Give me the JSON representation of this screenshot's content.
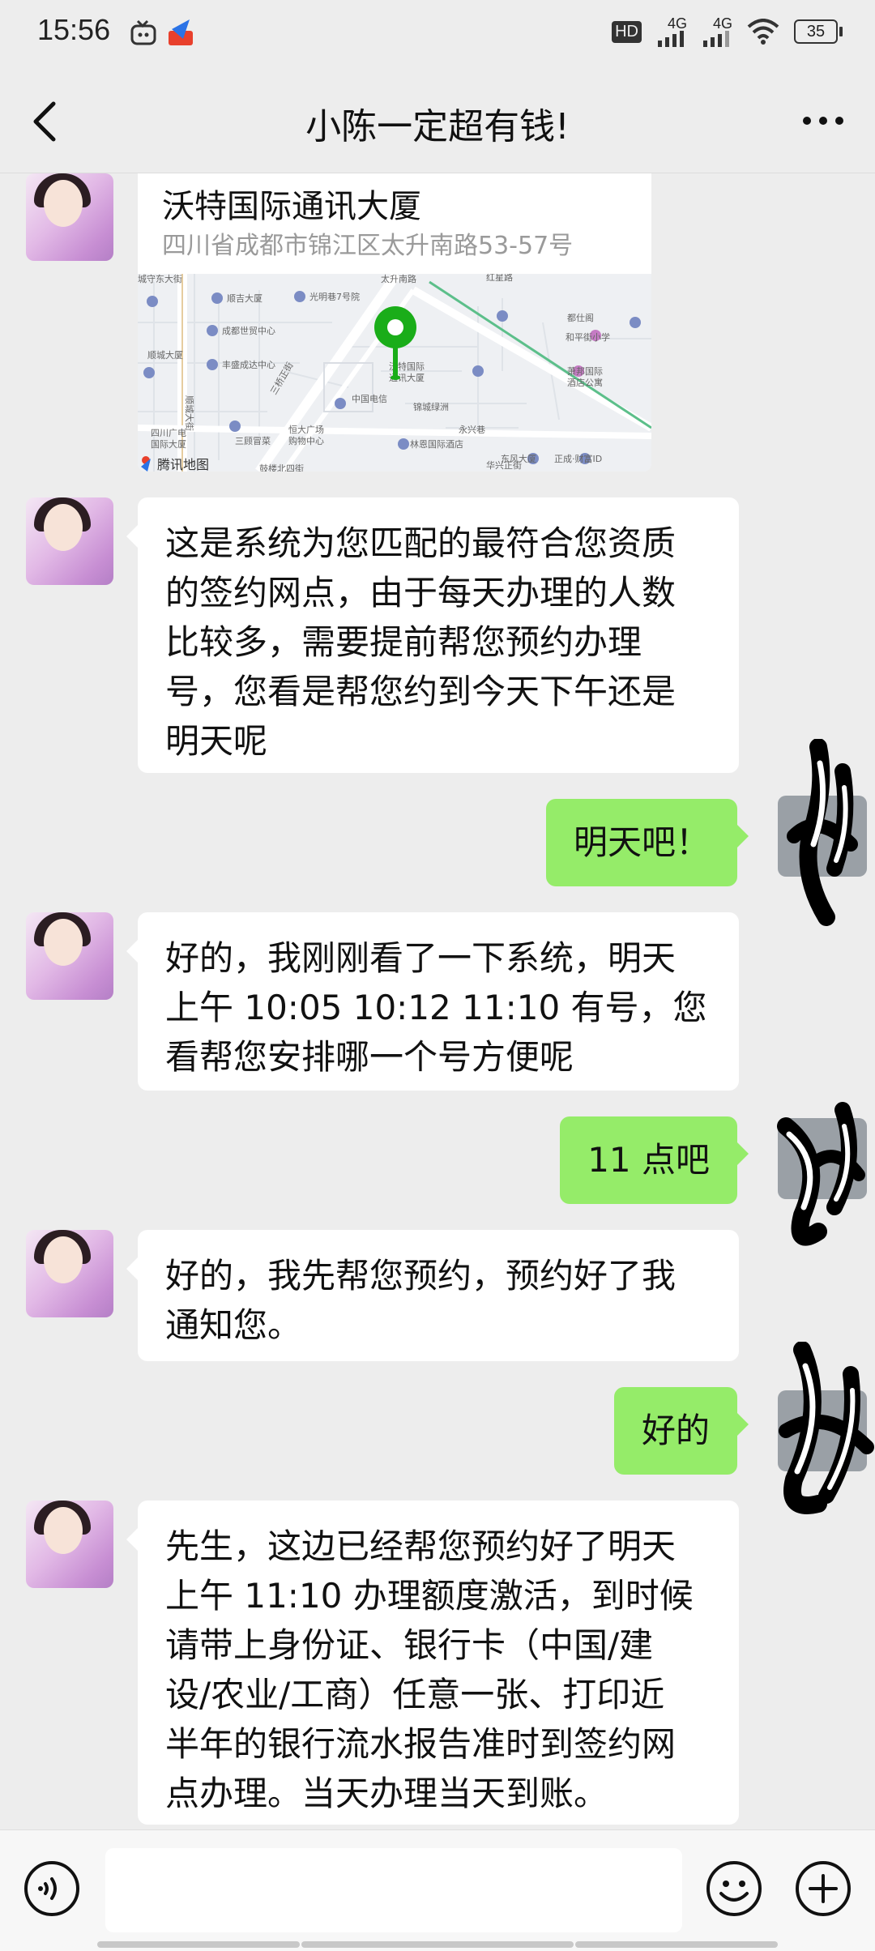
{
  "status_bar": {
    "time": "15:56",
    "network_1": "4G",
    "network_2": "4G",
    "hd_label": "HD",
    "battery": "35"
  },
  "header": {
    "title": "小陈一定超有钱!"
  },
  "location_card": {
    "name": "沃特国际通讯大厦",
    "address": "四川省成都市锦江区太升南路53-57号",
    "map_labels": [
      "太升南路",
      "顺吉大厦",
      "光明巷7号院",
      "都仕阁",
      "成都世贸中心",
      "和平街小学",
      "丰盛成达中心",
      "顺城大厦",
      "沃特国际通讯大厦",
      "萧邦国际酒店公寓",
      "三顾冒菜",
      "中国电信",
      "锦城绿洲",
      "恒大广场购物中心",
      "四川广电国际大厦",
      "林恩国际酒店",
      "永兴巷",
      "东风大厦",
      "正成·财富ID",
      "城守东大街",
      "华兴正街",
      "顺城大街",
      "三桥正街",
      "鼓楼北四街",
      "红星路"
    ],
    "map_watermark": "腾讯地图"
  },
  "messages": [
    {
      "side": "left",
      "text_lines": [
        "这是系统为您匹配的最符合您资质",
        "的签约网点，由于每天办理的人数",
        "比较多，需要提前帮您预约办理",
        "号，您看是帮您约到今天下午还是",
        "明天呢"
      ]
    },
    {
      "side": "right",
      "text": "明天吧！"
    },
    {
      "side": "left",
      "text_lines": [
        "好的，我刚刚看了一下系统，明天",
        "上午 10:05  10:12  11:10 有号，您",
        "看帮您安排哪一个号方便呢"
      ]
    },
    {
      "side": "right",
      "text": "11 点吧"
    },
    {
      "side": "left",
      "text_lines": [
        "好的，我先帮您预约，预约好了我",
        "通知您。"
      ]
    },
    {
      "side": "right",
      "text": "好的"
    },
    {
      "side": "left",
      "text_lines": [
        "先生，这边已经帮您预约好了明天",
        "上午 11:10 办理额度激活，到时候",
        "请带上身份证、银行卡（中国/建",
        "设/农业/工商）任意一张、打印近",
        "半年的银行流水报告准时到签约网",
        "点办理。当天办理当天到账。"
      ]
    }
  ],
  "colors": {
    "background": "#ededed",
    "bubble_self": "#95ec69",
    "bubble_other": "#ffffff",
    "map_pin": "#1aad19"
  }
}
